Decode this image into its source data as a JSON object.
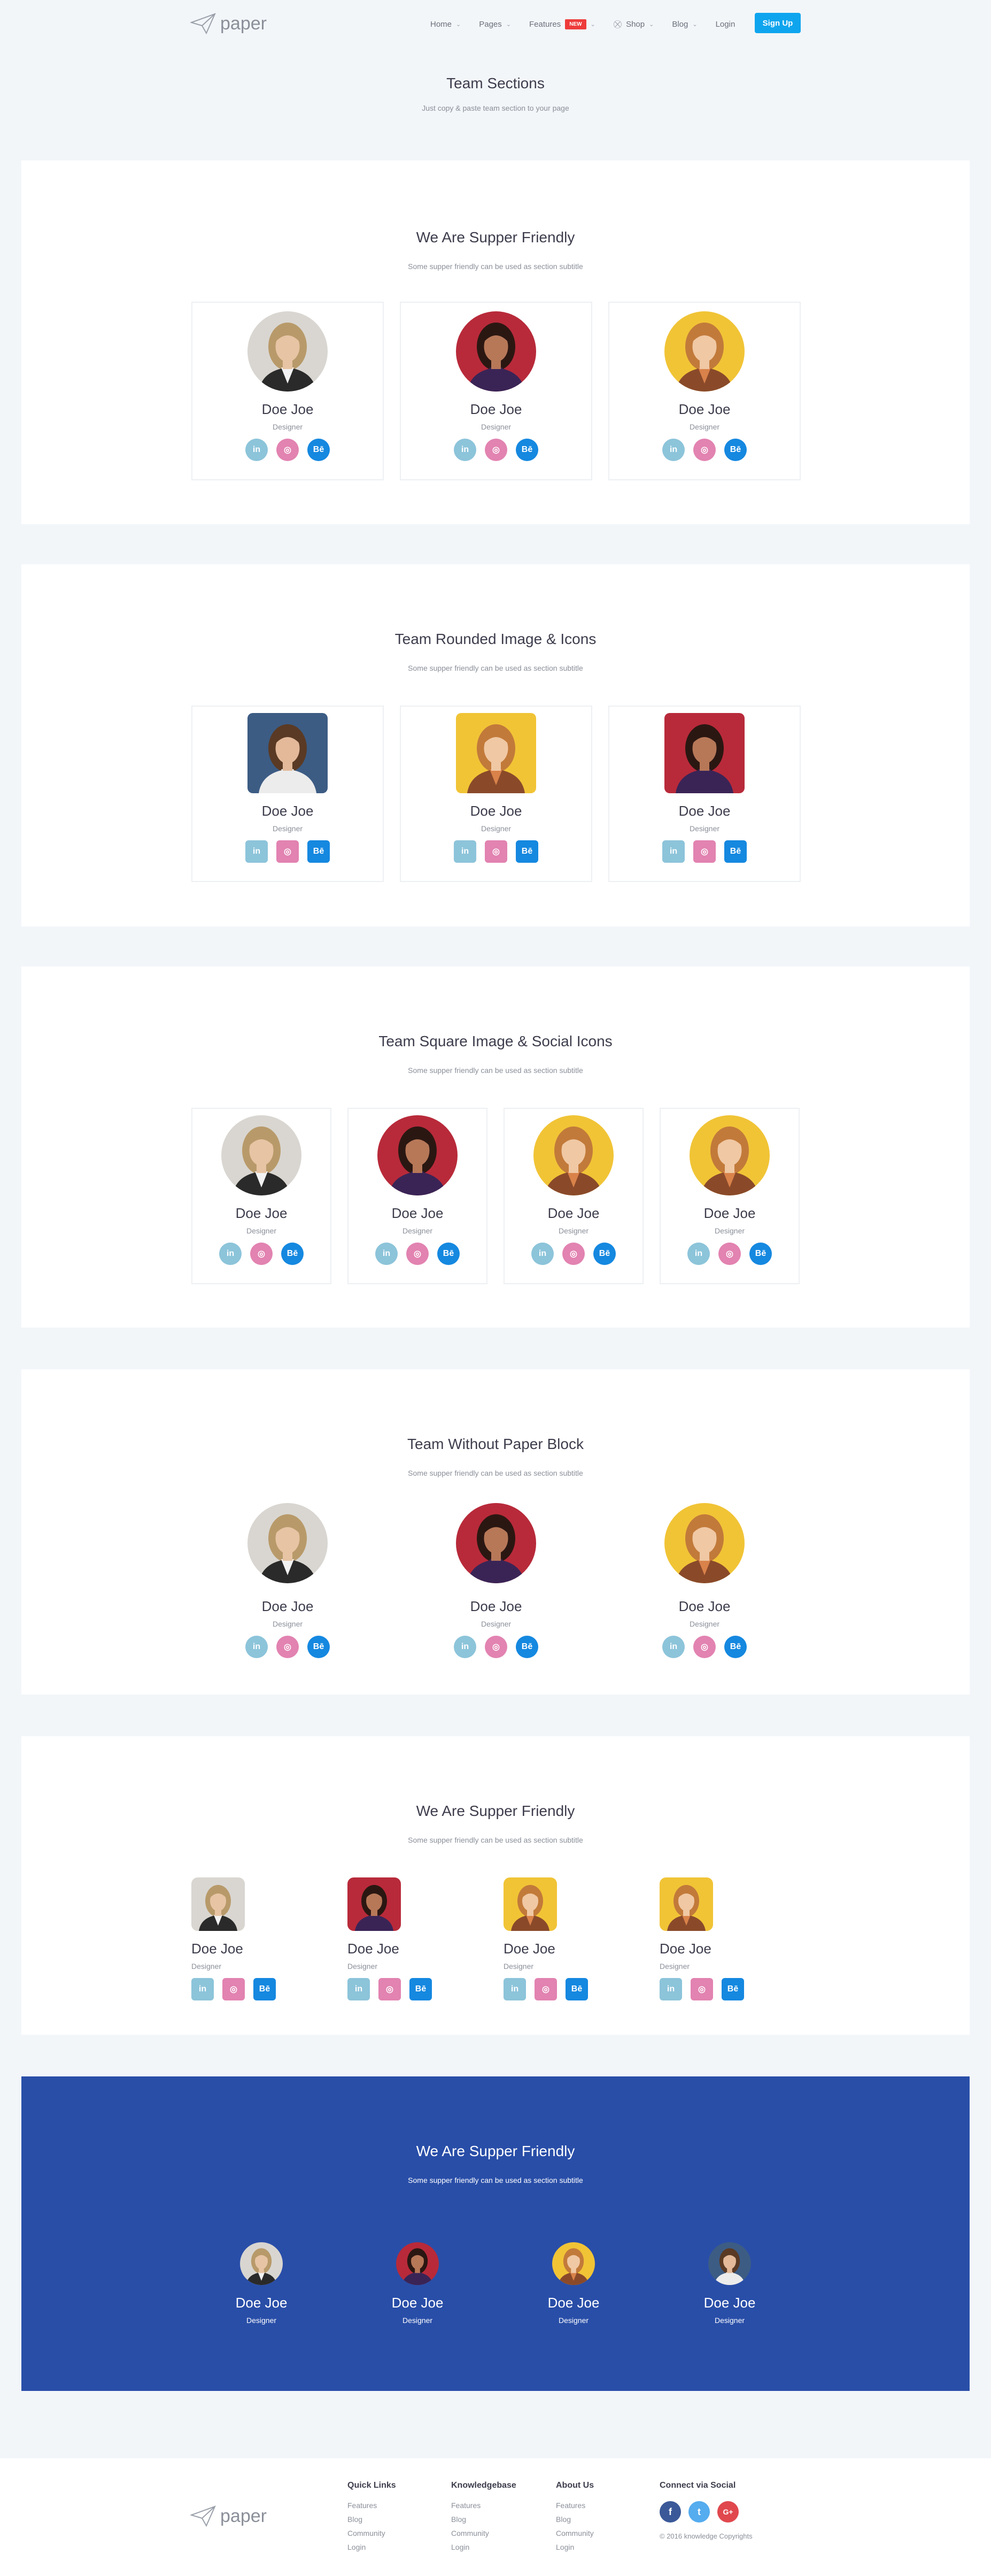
{
  "nav": {
    "brand": "paper",
    "items": [
      {
        "label": "Home",
        "chevron": true
      },
      {
        "label": "Pages",
        "chevron": true
      },
      {
        "label": "Features",
        "badge": "NEW",
        "chevron": true
      },
      {
        "label": "Shop",
        "chevron": true,
        "icon": "cart-icon"
      },
      {
        "label": "Blog",
        "chevron": true
      },
      {
        "label": "Login",
        "chevron": false
      }
    ],
    "signup": "Sign Up"
  },
  "page": {
    "title": "Team Sections",
    "subtitle": "Just copy & paste team section to your page"
  },
  "sections": [
    {
      "title": "We Are Supper Friendly",
      "subtitle": "Some supper friendly can be used as section subtitle"
    },
    {
      "title": "Team Rounded Image & Icons",
      "subtitle": "Some supper friendly can be used as section subtitle"
    },
    {
      "title": "Team Square Image & Social Icons",
      "subtitle": "Some supper friendly can be used as section subtitle"
    },
    {
      "title": "Team Without Paper Block",
      "subtitle": "Some supper friendly can be used as section subtitle"
    },
    {
      "title": "We Are Supper Friendly",
      "subtitle": "Some supper friendly can be used as section subtitle"
    },
    {
      "title": "We Are Supper Friendly",
      "subtitle": "Some supper friendly can be used as section subtitle"
    }
  ],
  "member": {
    "name": "Doe Joe",
    "role": "Designer"
  },
  "social": {
    "linkedin": "in",
    "dribbble": "◎",
    "behance": "Bē"
  },
  "footer": {
    "brand": "paper",
    "cols": [
      {
        "title": "Quick Links",
        "links": [
          "Features",
          "Blog",
          "Community",
          "Login"
        ]
      },
      {
        "title": "Knowledgebase",
        "links": [
          "Features",
          "Blog",
          "Community",
          "Login"
        ]
      },
      {
        "title": "About Us",
        "links": [
          "Features",
          "Blog",
          "Community",
          "Login"
        ]
      }
    ],
    "social_title": "Connect via Social",
    "social": [
      "f",
      "t",
      "G+"
    ],
    "copyright": "© 2016 knowledge Copyrights"
  },
  "colors": {
    "accent": "#0fa5ee",
    "blue_section": "#294ea8",
    "linkedin": "#8cc4da",
    "dribbble": "#e283b1",
    "behance": "#1588e0"
  }
}
